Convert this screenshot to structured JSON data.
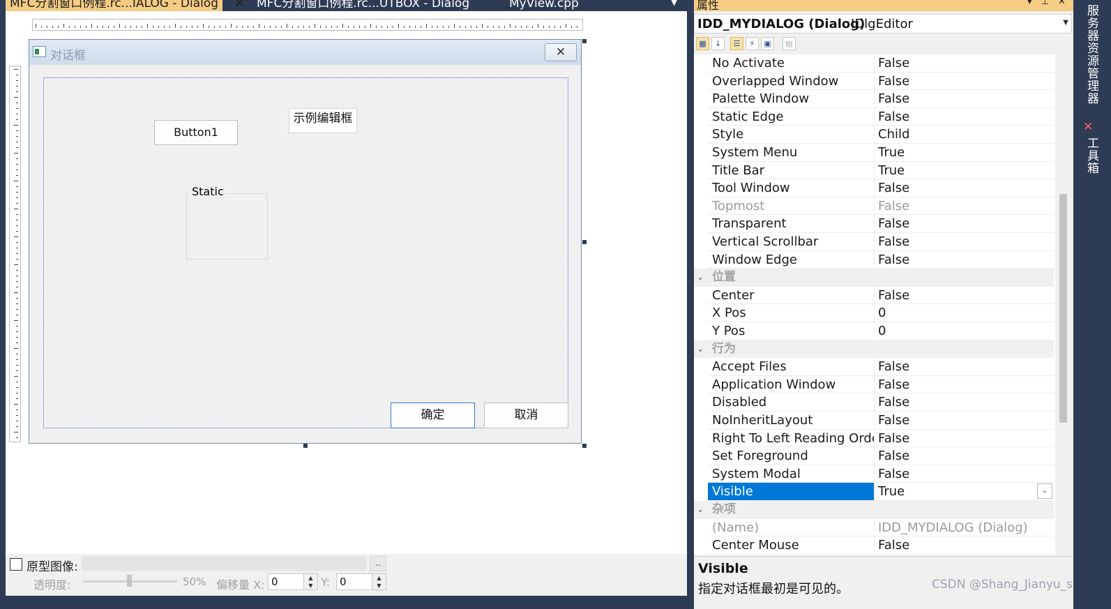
{
  "tabs": [
    {
      "label": "MFC分割窗口例程.rc...IALOG - Dialog",
      "active": true
    },
    {
      "label": "MFC分割窗口例程.rc...UTBOX - Dialog",
      "active": false
    },
    {
      "label": "MyView.cpp",
      "active": false
    }
  ],
  "tab_close_glyph": "✕",
  "dialog": {
    "caption": "对话框",
    "close_glyph": "✕",
    "button1_label": "Button1",
    "edit_text": "示例编辑框",
    "static_label": "Static",
    "ok_label": "确定",
    "cancel_label": "取消"
  },
  "prototype": {
    "label": "原型图像:",
    "path": "",
    "browse_label": "..",
    "opacity_label": "透明度:",
    "opacity_value": "50%",
    "offset_x_label": "偏移量 X:",
    "offset_x_value": "0",
    "offset_y_label": "Y:",
    "offset_y_value": "0"
  },
  "properties": {
    "panel_title": "属性",
    "object_name": "IDD_MYDIALOG (Dialog)",
    "object_type": "IDlgEditor",
    "rows": [
      {
        "name": "No Activate",
        "value": "False"
      },
      {
        "name": "Overlapped Window",
        "value": "False"
      },
      {
        "name": "Palette Window",
        "value": "False"
      },
      {
        "name": "Static Edge",
        "value": "False"
      },
      {
        "name": "Style",
        "value": "Child"
      },
      {
        "name": "System Menu",
        "value": "True"
      },
      {
        "name": "Title Bar",
        "value": "True"
      },
      {
        "name": "Tool Window",
        "value": "False"
      },
      {
        "name": "Topmost",
        "value": "False"
      },
      {
        "name": "Transparent",
        "value": "False"
      },
      {
        "name": "Vertical Scrollbar",
        "value": "False"
      },
      {
        "name": "Window Edge",
        "value": "False"
      },
      {
        "category": "位置"
      },
      {
        "name": "Center",
        "value": "False"
      },
      {
        "name": "X Pos",
        "value": "0"
      },
      {
        "name": "Y Pos",
        "value": "0"
      },
      {
        "category": "行为"
      },
      {
        "name": "Accept Files",
        "value": "False"
      },
      {
        "name": "Application Window",
        "value": "False"
      },
      {
        "name": "Disabled",
        "value": "False"
      },
      {
        "name": "NoInheritLayout",
        "value": "False"
      },
      {
        "name": "Right To Left Reading Orde",
        "value": "False"
      },
      {
        "name": "Set Foreground",
        "value": "False"
      },
      {
        "name": "System Modal",
        "value": "False"
      },
      {
        "name": "Visible",
        "value": "True"
      },
      {
        "category": "杂项"
      },
      {
        "name": "(Name)",
        "value": "IDD_MYDIALOG (Dialog)"
      },
      {
        "name": "Center Mouse",
        "value": "False"
      }
    ],
    "disabled_rows": [
      "Topmost",
      "(Name)"
    ],
    "selected_row": "Visible",
    "description_title": "Visible",
    "description_text": "指定对话框最初是可见的。"
  },
  "side_tabs": [
    "服务器资源管理器",
    "工具箱"
  ],
  "watermark": "CSDN @Shang_Jianyu_ss",
  "colors": {
    "chrome": "#2e3b55",
    "active_tab": "#f5cc84",
    "selection": "#0078d7",
    "dialog_bg": "#f0f0f0"
  }
}
